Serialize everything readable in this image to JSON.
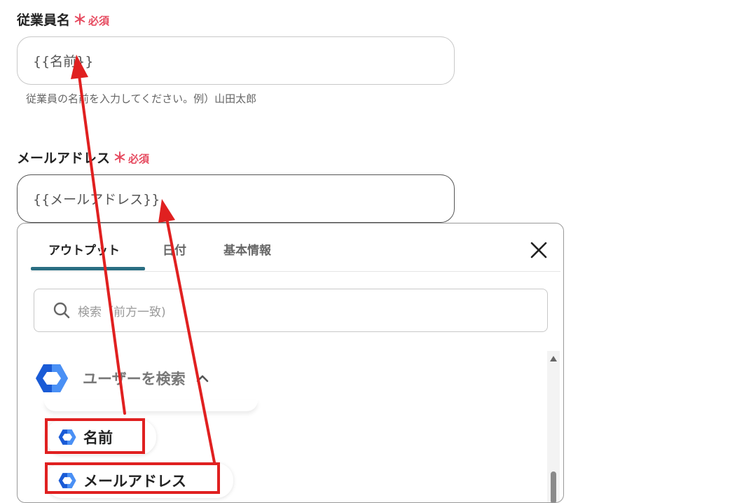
{
  "fields": [
    {
      "label": "従業員名",
      "required_mark": "＊",
      "required_text": "必須",
      "value": "{{名前}}",
      "help": "従業員の名前を入力してください。例）山田太郎"
    },
    {
      "label": "メールアドレス",
      "required_mark": "＊",
      "required_text": "必須",
      "value": "{{メールアドレス}}"
    }
  ],
  "panel": {
    "tabs": [
      {
        "label": "アウトプット",
        "active": true
      },
      {
        "label": "日付",
        "active": false
      },
      {
        "label": "基本情報",
        "active": false
      }
    ],
    "close_icon": "close-icon",
    "search": {
      "placeholder": "検索（前方一致)",
      "icon": "search-icon"
    },
    "group": {
      "title": "ユーザーを検索",
      "icon": "google-workspace-hexagon-icon",
      "chevron": "chevron-up-icon"
    },
    "items": [
      {
        "label": "名前",
        "icon": "hexagon-icon"
      },
      {
        "label": "メールアドレス",
        "icon": "hexagon-icon"
      }
    ]
  },
  "colors": {
    "required": "#e64a5f",
    "accent_underline": "#2a6e82",
    "annotation_red": "#e02020",
    "hex_blue_dark": "#1a5bd6",
    "hex_blue_light": "#4a90f5"
  }
}
